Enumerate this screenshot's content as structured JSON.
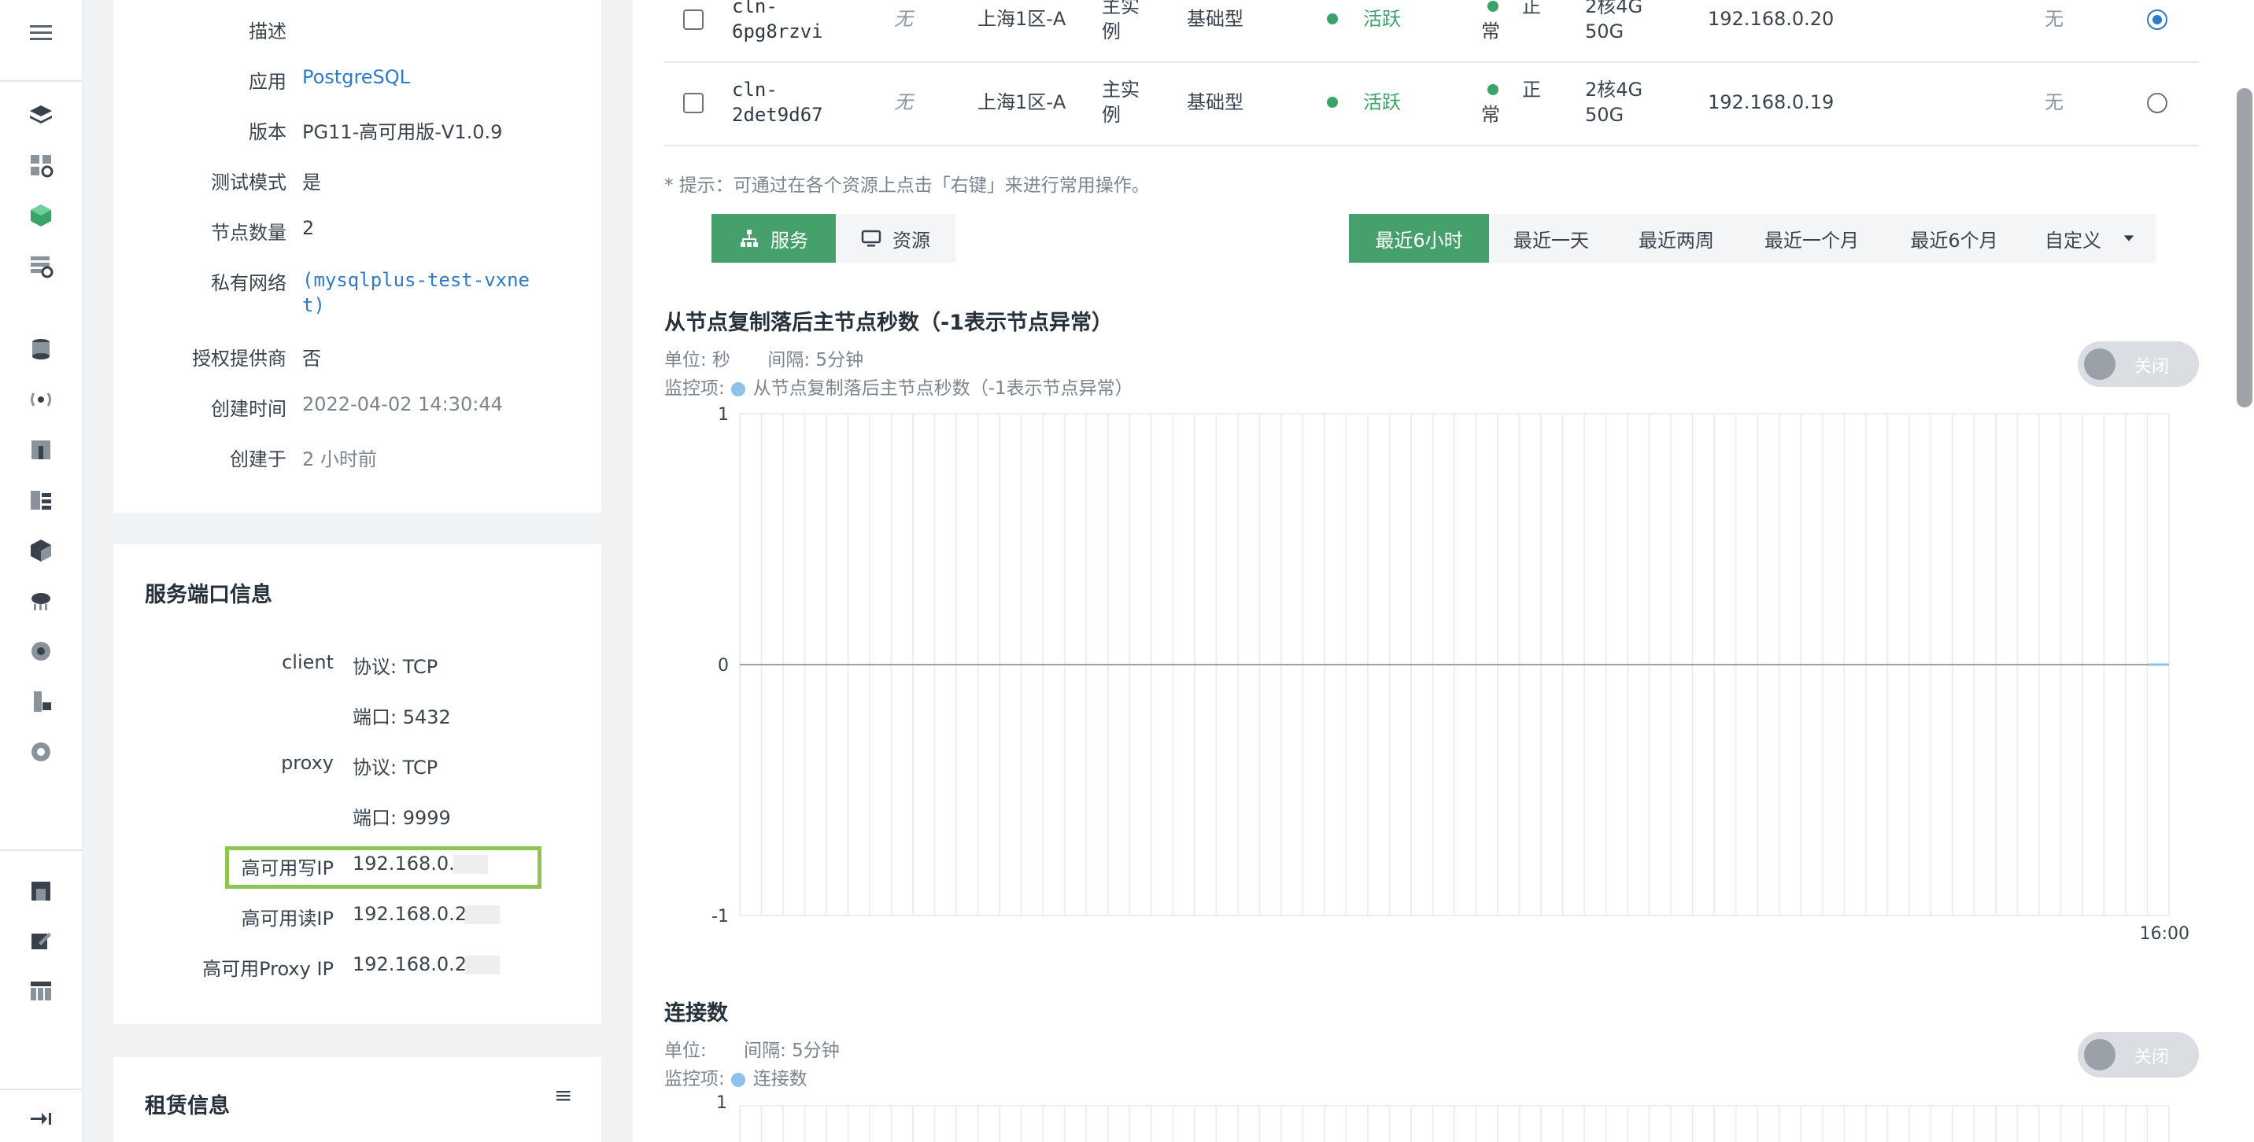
{
  "detail": {
    "rows": [
      {
        "label": "描述",
        "value": ""
      },
      {
        "label": "应用",
        "value": "PostgreSQL"
      },
      {
        "label": "版本",
        "value": "PG11-高可用版-V1.0.9"
      },
      {
        "label": "测试模式",
        "value": "是"
      },
      {
        "label": "节点数量",
        "value": "2"
      },
      {
        "label": "私有网络",
        "value_line1": "(mysqlplus-test-vxne",
        "value_line2": "t)"
      },
      {
        "label": "授权提供商",
        "value": "否"
      },
      {
        "label": "创建时间",
        "value": "2022-04-02 14:30:44"
      },
      {
        "label": "创建于",
        "value": "2 小时前"
      }
    ]
  },
  "ports": {
    "title": "服务端口信息",
    "rows": [
      {
        "label": "client",
        "value": "协议: TCP"
      },
      {
        "label": "",
        "value": "端口: 5432"
      },
      {
        "label": "proxy",
        "value": "协议: TCP"
      },
      {
        "label": "",
        "value": "端口: 9999"
      },
      {
        "label": "高可用写IP",
        "value": "192.168.0."
      },
      {
        "label": "高可用读IP",
        "value": "192.168.0.2"
      },
      {
        "label": "高可用Proxy IP",
        "value": "192.168.0.2"
      }
    ]
  },
  "lease": {
    "title": "租赁信息",
    "menu_icon": "≡"
  },
  "nodes": [
    {
      "id_line1": "cln-",
      "id_line2": "6pg8rzvi",
      "alias": "无",
      "zone": "上海1区-A",
      "role_line1": "主实",
      "role_line2": "例",
      "type": "基础型",
      "status": "活跃",
      "health_line1": "正",
      "health_line2": "常",
      "spec_line1": "2核4G",
      "spec_line2": "50G",
      "ip": "192.168.0.20",
      "extra": "无",
      "selected": true
    },
    {
      "id_line1": "cln-",
      "id_line2": "2det9d67",
      "alias": "无",
      "zone": "上海1区-A",
      "role_line1": "主实",
      "role_line2": "例",
      "type": "基础型",
      "status": "活跃",
      "health_line1": "正",
      "health_line2": "常",
      "spec_line1": "2核4G",
      "spec_line2": "50G",
      "ip": "192.168.0.19",
      "extra": "无",
      "selected": false
    }
  ],
  "hint": "* 提示：可通过在各个资源上点击「右键」来进行常用操作。",
  "view_tabs": {
    "service": "服务",
    "resource": "资源"
  },
  "time_ranges": [
    "最近6小时",
    "最近一天",
    "最近两周",
    "最近一个月",
    "最近6个月",
    "自定义"
  ],
  "active_range": "最近6小时",
  "chart1": {
    "title": "从节点复制落后主节点秒数（-1表示节点异常）",
    "unit": "单位: 秒",
    "interval": "间隔: 5分钟",
    "monitor_label": "监控项:",
    "toggle": "关闭"
  },
  "chart2": {
    "title": "连接数",
    "unit": "单位:",
    "interval": "间隔: 5分钟",
    "monitor_label": "监控项:",
    "legend": "连接数",
    "toggle": "关闭",
    "ytop": "1"
  },
  "chart_data": {
    "type": "line",
    "title": "从节点复制落后主节点秒数（-1表示节点异常）",
    "series": [
      {
        "name": "从节点复制落后主节点秒数（-1表示节点异常）",
        "values": [
          0
        ]
      }
    ],
    "x": [
      "16:00"
    ],
    "ylim": [
      -1,
      1
    ],
    "yticks": [
      "1",
      "0",
      "-1"
    ],
    "xtick": "16:00",
    "grid": true,
    "series_color": "#8cc1ec"
  }
}
